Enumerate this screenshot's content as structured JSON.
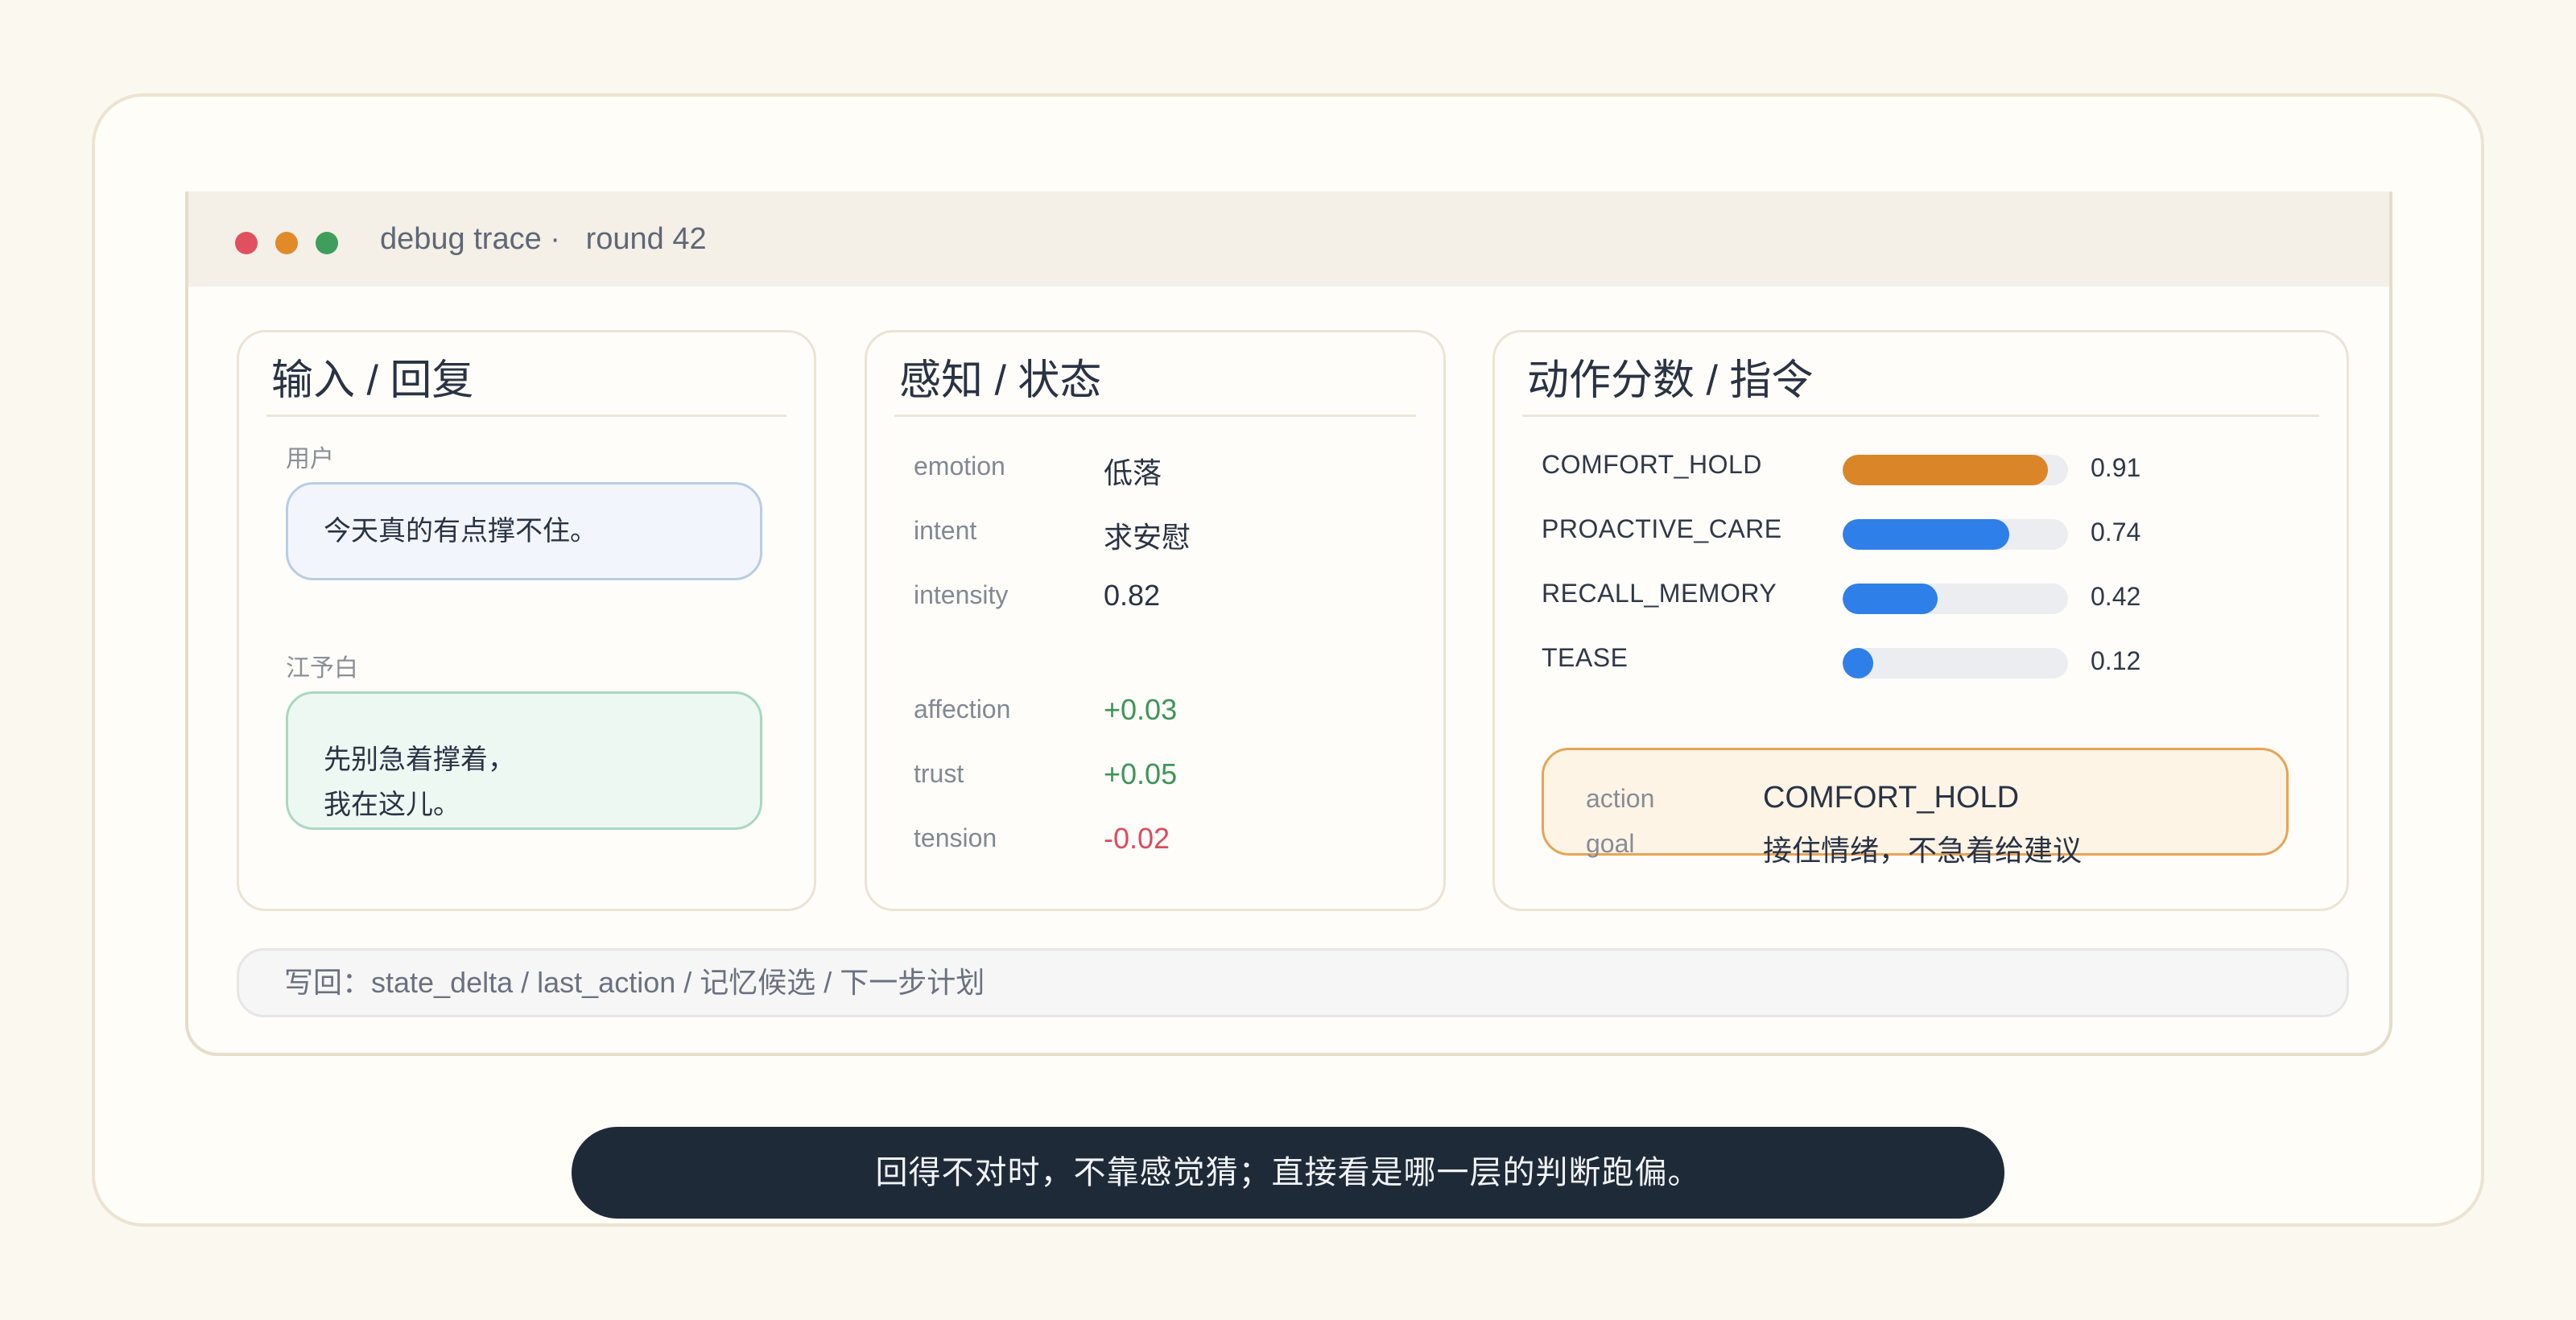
{
  "window": {
    "title": "debug trace ·",
    "round": "round 42",
    "controls": {
      "close_color": "#e0505f",
      "minimize_color": "#e08a2a",
      "maximize_color": "#3f9e5c"
    }
  },
  "input_panel": {
    "title": "输入 / 回复",
    "user_label": "用户",
    "user_message": "今天真的有点撑不住。",
    "reply_label": "江予白",
    "reply_lines": [
      "先别急着撑着，",
      "我在这儿。"
    ]
  },
  "state_panel": {
    "title": "感知 / 状态",
    "perception": [
      {
        "label": "emotion",
        "value": "低落"
      },
      {
        "label": "intent",
        "value": "求安慰"
      },
      {
        "label": "intensity",
        "value": "0.82"
      }
    ],
    "deltas": [
      {
        "label": "affection",
        "value": "+0.03",
        "sign": "positive"
      },
      {
        "label": "trust",
        "value": "+0.05",
        "sign": "positive"
      },
      {
        "label": "tension",
        "value": "-0.02",
        "sign": "negative"
      }
    ]
  },
  "action_panel": {
    "title": "动作分数 / 指令",
    "scores": [
      {
        "label": "COMFORT_HOLD",
        "value": 0.91,
        "display": "0.91",
        "color": "#da8527"
      },
      {
        "label": "PROACTIVE_CARE",
        "value": 0.74,
        "display": "0.74",
        "color": "#2f7fe8"
      },
      {
        "label": "RECALL_MEMORY",
        "value": 0.42,
        "display": "0.42",
        "color": "#2f7fe8"
      },
      {
        "label": "TEASE",
        "value": 0.12,
        "display": "0.12",
        "color": "#2f7fe8"
      }
    ],
    "directive": {
      "action_label": "action",
      "action_value": "COMFORT_HOLD",
      "goal_label": "goal",
      "goal_value": "接住情绪，不急着给建议"
    }
  },
  "writeback": "写回：state_delta / last_action / 记忆候选 / 下一步计划",
  "caption": "回得不对时，不靠感觉猜；直接看是哪一层的判断跑偏。",
  "colors": {
    "background": "#fbf8f0",
    "accent_orange": "#da8527",
    "accent_blue": "#2f7fe8",
    "positive": "#3f9458",
    "negative": "#de4b5e",
    "caption_bg": "#1e2a38"
  }
}
